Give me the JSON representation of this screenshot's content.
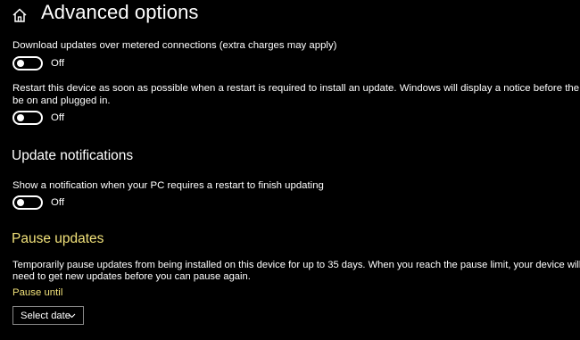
{
  "header": {
    "title": "Advanced options",
    "home_icon": "home-icon"
  },
  "metered": {
    "description": "Download updates over metered connections (extra charges may apply)",
    "toggle_state": "Off"
  },
  "restart": {
    "description": "Restart this device as soon as possible when a restart is required to install an update. Windows will display a notice before the restart, and the",
    "description_line2": "be on and plugged in.",
    "toggle_state": "Off"
  },
  "update_notifications": {
    "heading": "Update notifications",
    "description": "Show a notification when your PC requires a restart to finish updating",
    "toggle_state": "Off"
  },
  "pause_updates": {
    "heading": "Pause updates",
    "description_line1": "Temporarily pause updates from being installed on this device for up to 35 days. When you reach the pause limit, your device will",
    "description_line2": "need to get new updates before you can pause again.",
    "pause_until_label": "Pause until",
    "select_value": "Select date",
    "chevron_icon": "chevron-down-icon"
  },
  "colors": {
    "background": "#000000",
    "text": "#ffffff",
    "accent_heading": "#f2e27a",
    "select_border": "#8a8a8a"
  }
}
